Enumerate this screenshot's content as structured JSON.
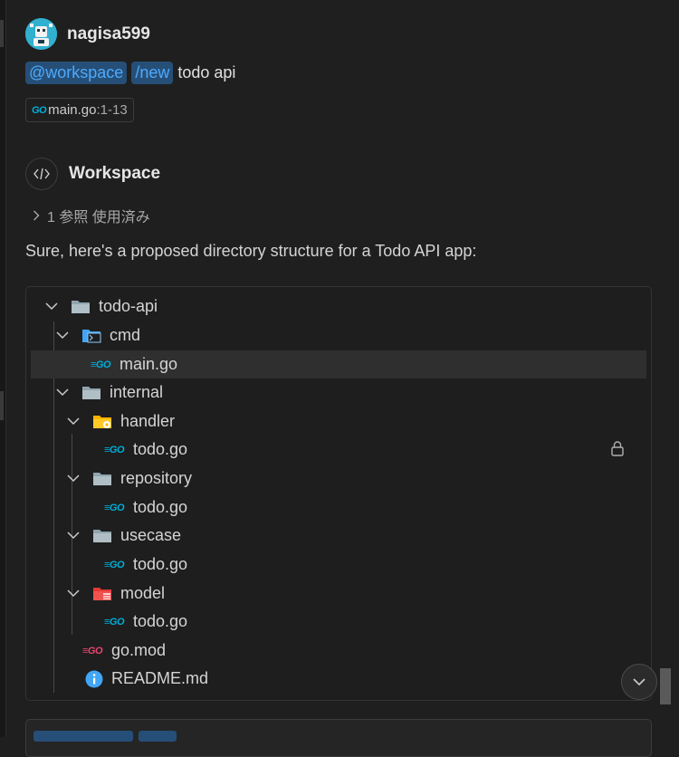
{
  "user": {
    "name": "nagisa599"
  },
  "prompt": {
    "agent_chip": "@workspace",
    "command_chip": "/new",
    "text": "todo api"
  },
  "reference": {
    "badge": "GO",
    "file": "main.go",
    "range": ":1-13"
  },
  "response": {
    "agent_name": "Workspace",
    "references_label": "1 参照 使用済み",
    "message": "Sure, here's a proposed directory structure for a Todo API app:"
  },
  "file_tree": {
    "rows": [
      {
        "name": "todo-api",
        "type": "folder",
        "icon": "folder-icon",
        "expanded": true
      },
      {
        "name": "cmd",
        "type": "folder",
        "icon": "terminal-folder-icon",
        "expanded": true
      },
      {
        "name": "main.go",
        "type": "go-file",
        "icon": "go-icon",
        "selected": true
      },
      {
        "name": "internal",
        "type": "folder",
        "icon": "folder-icon",
        "expanded": true
      },
      {
        "name": "handler",
        "type": "folder",
        "icon": "gear-folder-icon",
        "expanded": true
      },
      {
        "name": "todo.go",
        "type": "go-file",
        "icon": "go-icon"
      },
      {
        "name": "repository",
        "type": "folder",
        "icon": "folder-icon",
        "expanded": true
      },
      {
        "name": "todo.go",
        "type": "go-file",
        "icon": "go-icon"
      },
      {
        "name": "usecase",
        "type": "folder",
        "icon": "folder-icon",
        "expanded": true
      },
      {
        "name": "todo.go",
        "type": "go-file",
        "icon": "go-icon"
      },
      {
        "name": "model",
        "type": "folder",
        "icon": "model-folder-icon",
        "expanded": true
      },
      {
        "name": "todo.go",
        "type": "go-file",
        "icon": "go-icon"
      },
      {
        "name": "go.mod",
        "type": "go-mod",
        "icon": "go-mod-icon"
      },
      {
        "name": "README.md",
        "type": "readme",
        "icon": "info-icon"
      }
    ]
  },
  "colors": {
    "background": "#1f1f1f",
    "chip_bg": "#264f78",
    "chip_text": "#4daafc",
    "go_blue": "#00add8",
    "go_red": "#e5456f"
  }
}
